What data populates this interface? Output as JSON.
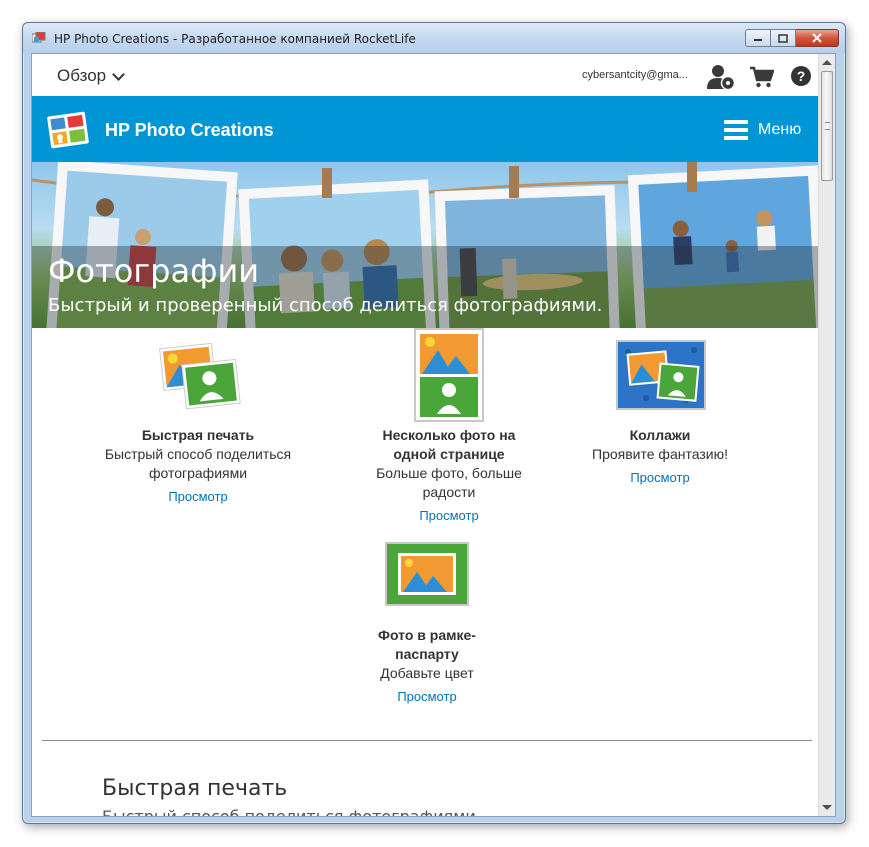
{
  "window": {
    "title": "HP Photo Creations - Разработанное компанией RocketLife"
  },
  "topnav": {
    "overview_label": "Обзор",
    "email": "cybersantcity@gma..."
  },
  "header": {
    "brand": "HP Photo Creations",
    "menu_label": "Меню",
    "color": "#0096d6"
  },
  "hero": {
    "title": "Фотографии",
    "subtitle": "Быстрый и проверенный способ делиться фотографиями."
  },
  "products": [
    {
      "title": "Быстрая печать",
      "desc_line1": "Быстрый способ поделиться",
      "desc_line2": "фотографиями",
      "link": "Просмотр"
    },
    {
      "title_line1": "Несколько фото на",
      "title_line2": "одной странице",
      "desc_line1": "Больше фото, больше",
      "desc_line2": "радости",
      "link": "Просмотр"
    },
    {
      "title": "Коллажи",
      "desc_line1": "Проявите фантазию!",
      "link": "Просмотр"
    },
    {
      "title_line1": "Фото в рамке-",
      "title_line2": "паспарту",
      "desc_line1": "Добавьте цвет",
      "link": "Просмотр"
    }
  ],
  "section": {
    "title": "Быстрая печать",
    "subtitle": "Быстрый способ поделиться фотографиями"
  },
  "colors": {
    "link": "#0072b8",
    "text": "#333333"
  }
}
